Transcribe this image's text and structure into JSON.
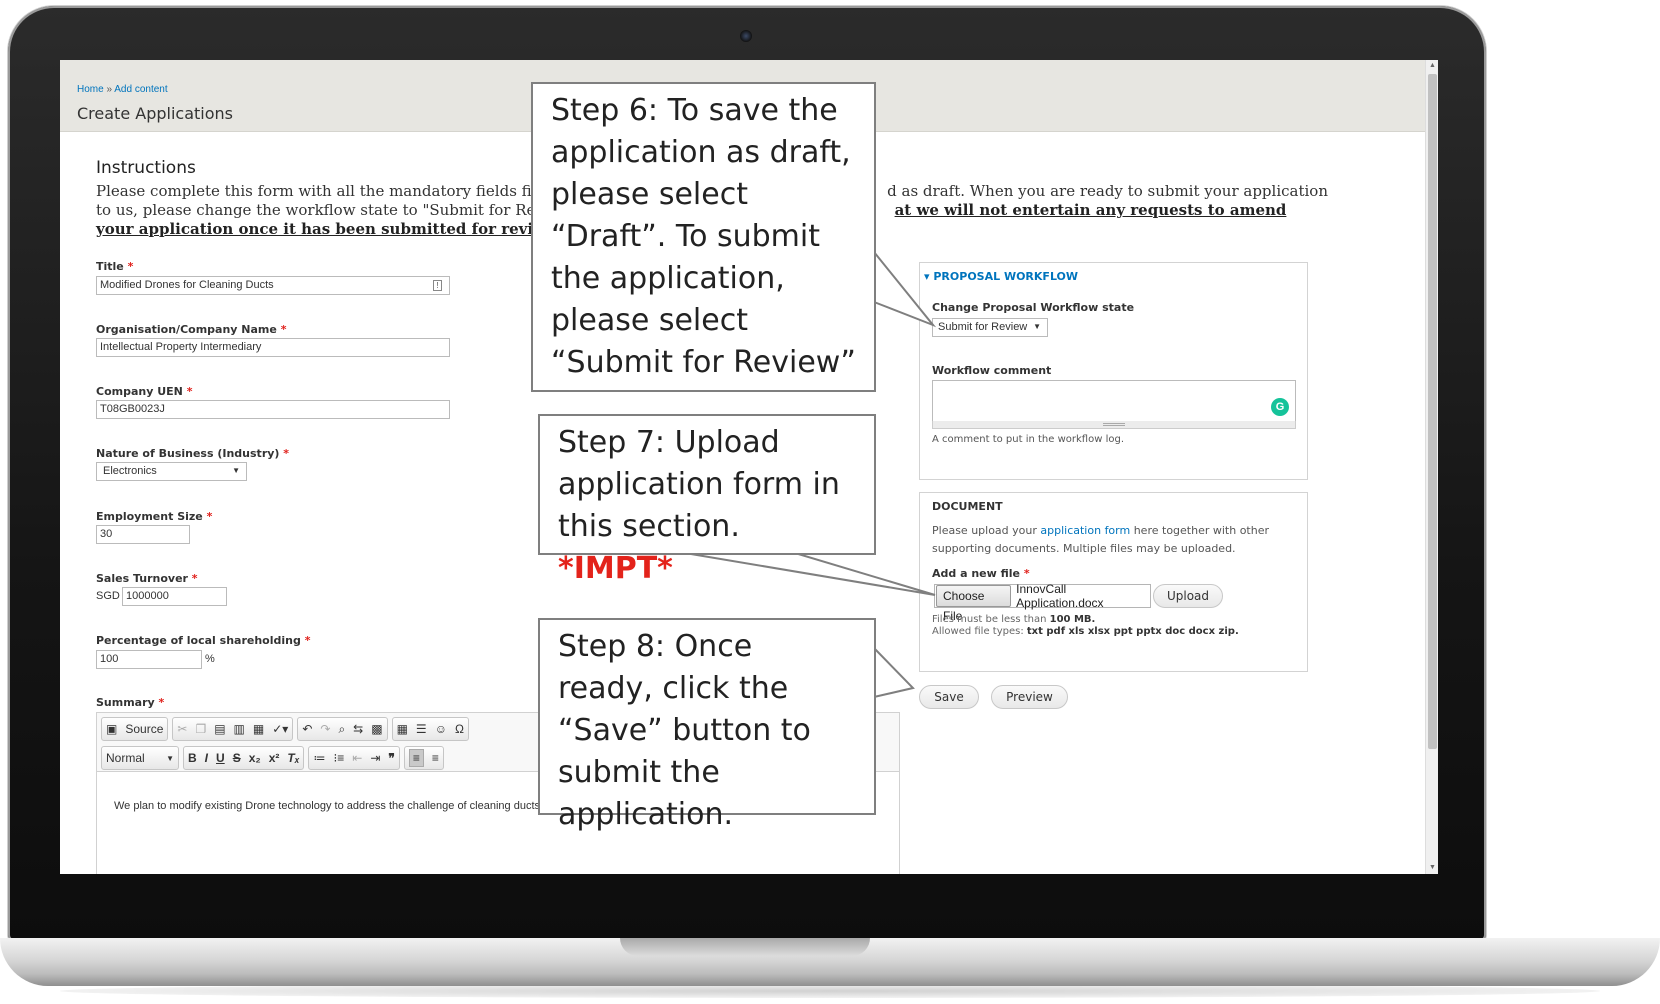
{
  "breadcrumb": {
    "home": "Home",
    "separator": "»",
    "current": "Add content"
  },
  "page_title": "Create Applications",
  "instructions": {
    "title": "Instructions",
    "line1_start": "Please complete this form with all the mandatory fields fille",
    "line1_end": "d as draft. When you are ready to submit your application",
    "line2_start": "to us, please change the workflow state to \"Submit for Revie",
    "line2_end": "at we will not entertain any requests to amend",
    "line3": "your application once it has been submitted for review."
  },
  "form": {
    "required_marker": "*",
    "title": {
      "label": "Title",
      "value": "Modified Drones for Cleaning Ducts"
    },
    "organisation": {
      "label": "Organisation/Company Name",
      "value": "Intellectual Property Intermediary"
    },
    "uen": {
      "label": "Company UEN",
      "value": "T08GB0023J"
    },
    "industry": {
      "label": "Nature of Business (Industry)",
      "value": "Electronics"
    },
    "employment": {
      "label": "Employment Size",
      "value": "30"
    },
    "turnover": {
      "label": "Sales Turnover",
      "prefix": "SGD",
      "value": "1000000"
    },
    "shareholding": {
      "label": "Percentage of local shareholding",
      "value": "100",
      "suffix": "%"
    },
    "summary": {
      "label": "Summary",
      "toolbar": {
        "source": "Source",
        "format": "Normal"
      },
      "body": "We plan to modify existing Drone technology to address the challenge of cleaning ducts."
    }
  },
  "workflow_panel": {
    "legend": "PROPOSAL WORKFLOW",
    "state_label": "Change Proposal Workflow state",
    "state_value": "Submit for Review",
    "comment_label": "Workflow comment",
    "comment_help": "A comment to put in the workflow log."
  },
  "document_panel": {
    "heading": "DOCUMENT",
    "text_before": "Please upload your ",
    "link": "application form",
    "text_after": " here together with other supporting documents. Multiple files may be uploaded.",
    "add_file_label": "Add a new file",
    "choose_button": "Choose File",
    "file_name": "InnovCall Application.docx",
    "upload_button": "Upload",
    "size_note_prefix": "Files must be less than ",
    "size_note_value": "100 MB.",
    "types_prefix": "Allowed file types: ",
    "types_value": "txt pdf xls xlsx ppt pptx doc docx zip."
  },
  "actions": {
    "save": "Save",
    "preview": "Preview"
  },
  "callouts": {
    "step6": "Step 6: To save  the application as draft, please select “Draft”. To submit the application, please select “Submit for Review”",
    "step7_text": "Step 7: Upload application form in this section. ",
    "step7_emphasis": "*IMPT*",
    "step8": "Step 8: Once ready, click the “Save” button to submit the application."
  }
}
